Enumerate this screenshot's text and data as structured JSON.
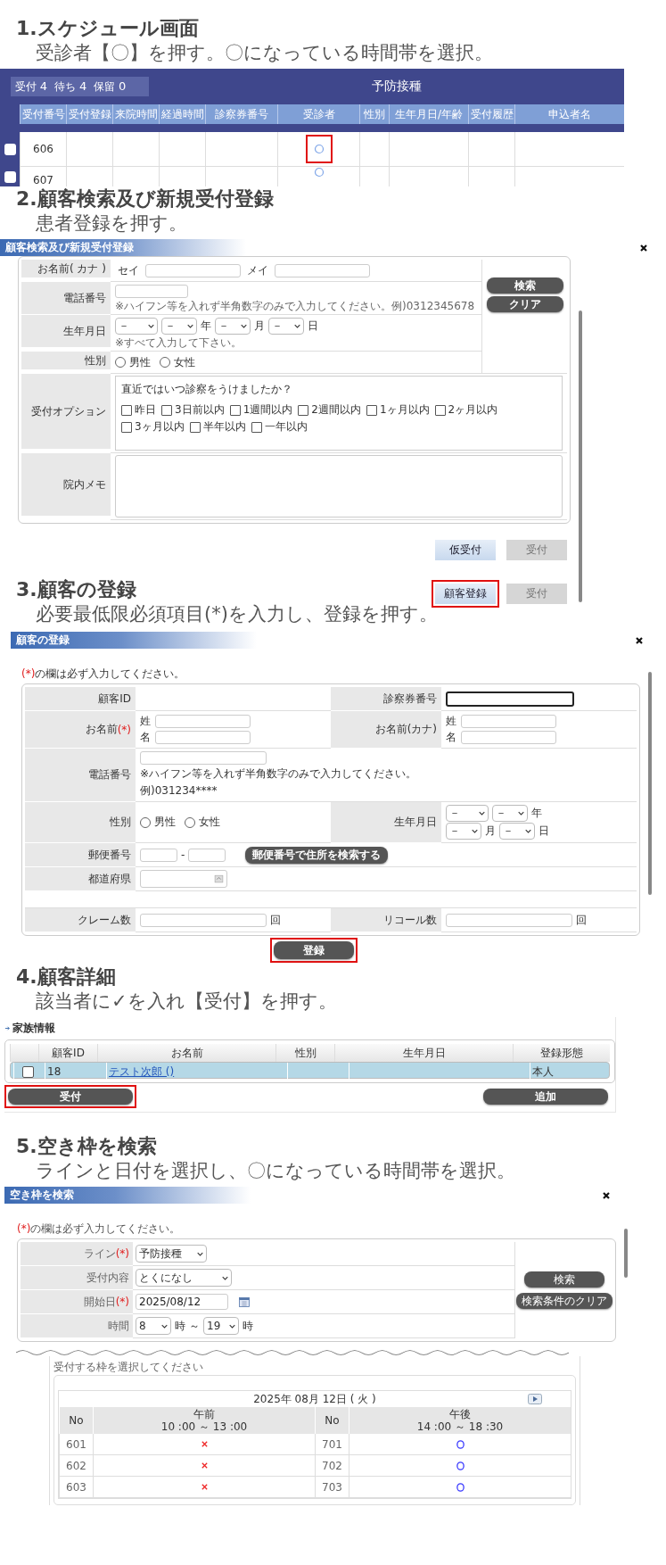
{
  "step_1": {
    "title": "1.スケジュール画面",
    "instruction": "受診者【〇】を押す。〇になっている時間帯を選択。"
  },
  "schedule_screen": {
    "counts": [
      {
        "label": "受付",
        "value": "4"
      },
      {
        "label": "待ち",
        "value": "4"
      },
      {
        "label": "保留",
        "value": "0"
      }
    ],
    "line_title": "予防接種",
    "columns": [
      "受付番号",
      "受付登録",
      "来院時間",
      "経過時間",
      "診察券番号",
      "受診者",
      "性別",
      "生年月日/年齢",
      "受付履歴",
      "申込者名"
    ],
    "rows": [
      {
        "number": "606",
        "checked": false,
        "highlighted": true
      },
      {
        "number": "607",
        "checked": false,
        "highlighted": false
      }
    ]
  },
  "step_2": {
    "title": "2.顧客検索及び新規受付登録",
    "instruction": "患者登録を押す。"
  },
  "search_dialog": {
    "title": "顧客検索及び新規受付登録",
    "kana": {
      "label": "お名前( カナ )",
      "first": "セイ",
      "last": "メイ"
    },
    "phone": {
      "label": "電話番号",
      "note": "※ハイフン等を入れず半角数字のみで入力してください。例)0312345678"
    },
    "birth": {
      "label": "生年月日",
      "selects": [
        {
          "value": "－"
        },
        {
          "value": "－",
          "unit": "年"
        },
        {
          "value": "－",
          "unit": "月"
        },
        {
          "value": "－",
          "unit": "日"
        }
      ],
      "note": "※すべて入力して下さい。"
    },
    "gender": {
      "label": "性別",
      "options": [
        {
          "label": "男性",
          "selected": false
        },
        {
          "label": "女性",
          "selected": false
        }
      ]
    },
    "side_buttons": [
      "検索",
      "クリア"
    ],
    "options": {
      "label": "受付オプション",
      "question": "直近ではいつ診察をうけましたか？",
      "choices": [
        {
          "label": "昨日",
          "checked": false
        },
        {
          "label": "3日前以内",
          "checked": false
        },
        {
          "label": "1週間以内",
          "checked": false
        },
        {
          "label": "2週間以内",
          "checked": false
        },
        {
          "label": "1ヶ月以内",
          "checked": false
        },
        {
          "label": "2ヶ月以内",
          "checked": false
        },
        {
          "label": "3ヶ月以内",
          "checked": false
        },
        {
          "label": "半年以内",
          "checked": false
        },
        {
          "label": "一年以内",
          "checked": false
        }
      ]
    },
    "memo": {
      "label": "院内メモ"
    },
    "footer_rows": [
      [
        {
          "label": "仮受付",
          "disabled": false,
          "highlighted": false
        },
        {
          "label": "受付",
          "disabled": true,
          "highlighted": false
        }
      ],
      [
        {
          "label": "顧客登録",
          "disabled": false,
          "highlighted": true
        },
        {
          "label": "受付",
          "disabled": true,
          "highlighted": false
        }
      ]
    ]
  },
  "step_3": {
    "title": "3.顧客の登録",
    "instruction": "必要最低限必須項目(*)を入力し、登録を押す。"
  },
  "register_dialog": {
    "title": "顧客の登録",
    "required_mark": "(*)",
    "required_note": "の欄は必ず入力してください。",
    "customer_id": {
      "label": "顧客ID"
    },
    "card_number": {
      "label": "診察券番号"
    },
    "name": {
      "label": "お名前",
      "required_mark": "(*)",
      "parts": [
        "姓",
        "名"
      ]
    },
    "kana": {
      "label": "お名前(カナ)",
      "parts": [
        "姓",
        "名"
      ]
    },
    "phone": {
      "label": "電話番号",
      "note": "※ハイフン等を入れず半角数字のみで入力してください。",
      "example": "例)031234****"
    },
    "gender": {
      "label": "性別",
      "options": [
        {
          "label": "男性",
          "selected": false
        },
        {
          "label": "女性",
          "selected": false
        }
      ]
    },
    "birth": {
      "label": "生年月日",
      "selects": [
        {
          "value": "－"
        },
        {
          "value": "－",
          "unit": "年"
        },
        {
          "value": "－",
          "unit": "月"
        },
        {
          "value": "－",
          "unit": "日"
        }
      ]
    },
    "postal": {
      "label": "郵便番号",
      "separator": "-",
      "button": "郵便番号で住所を検索する"
    },
    "prefecture": {
      "label": "都道府県"
    },
    "claims": {
      "label": "クレーム数",
      "unit": "回"
    },
    "recalls": {
      "label": "リコール数",
      "unit": "回"
    },
    "submit": {
      "label": "登録",
      "highlighted": true
    }
  },
  "step_4": {
    "title": "4.顧客詳細",
    "instruction": "該当者に✓を入れ【受付】を押す。"
  },
  "family_info": {
    "title": "家族情報",
    "columns": [
      "顧客ID",
      "お名前",
      "性別",
      "生年月日",
      "登録形態"
    ],
    "rows": [
      {
        "checked": false,
        "selected": true,
        "id": "18",
        "name": "テスト次郎 ()",
        "registration": "本人"
      }
    ],
    "buttons": [
      {
        "label": "受付",
        "highlighted": true
      },
      {
        "label": "追加",
        "highlighted": false
      }
    ]
  },
  "step_5": {
    "title": "5.空き枠を検索",
    "instruction": "ラインと日付を選択し、〇になっている時間帯を選択。"
  },
  "slot_search_dialog": {
    "title": "空き枠を検索",
    "required_mark": "(*)",
    "required_note": "の欄は必ず入力してください。",
    "fields": [
      {
        "kind": "select",
        "label": "ライン",
        "mark": "(*)",
        "value": "予防接種"
      },
      {
        "kind": "select",
        "label": "受付内容",
        "value": "とくになし"
      },
      {
        "kind": "date",
        "label": "開始日",
        "mark": "(*)",
        "value": "2025/08/12"
      },
      {
        "kind": "time",
        "label": "時間",
        "from": "8",
        "from_unit": "時",
        "separator": "～",
        "to": "19",
        "to_unit": "時"
      }
    ],
    "buttons": [
      "検索",
      "検索条件のクリア"
    ]
  },
  "slot_table": {
    "prompt": "受付する枠を選択してください",
    "date": "2025年 08月 12日 ( 火 )",
    "columns": [
      {
        "title": "No"
      },
      {
        "title": "午前",
        "range": "10 :00 ～ 13 :00"
      },
      {
        "title": "No"
      },
      {
        "title": "午後",
        "range": "14 :00 ～ 18 :30"
      }
    ],
    "rows": [
      {
        "am_no": "601",
        "am_open": false,
        "pm_no": "701",
        "pm_open": true
      },
      {
        "am_no": "602",
        "am_open": false,
        "pm_no": "702",
        "pm_open": true
      },
      {
        "am_no": "603",
        "am_open": false,
        "pm_no": "703",
        "pm_open": true
      }
    ]
  }
}
